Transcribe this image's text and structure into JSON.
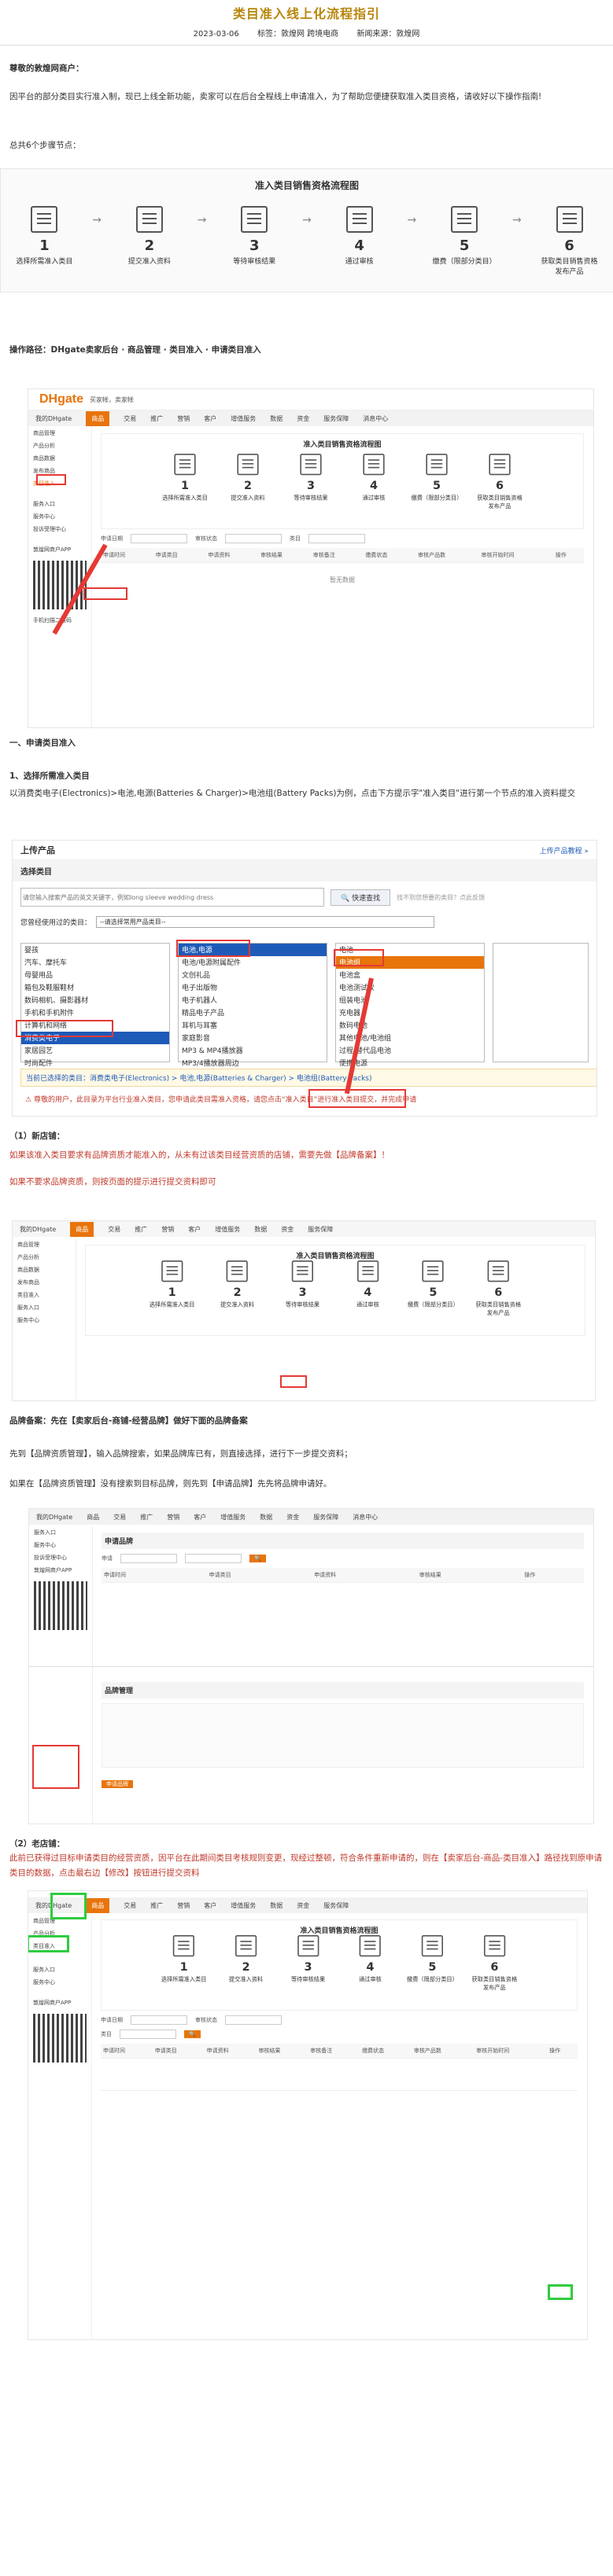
{
  "header": {
    "title": "类目准入线上化流程指引",
    "date": "2023-03-06",
    "tags": "标签：敦煌网 跨境电商",
    "source": "新闻来源：敦煌网"
  },
  "intro": {
    "greeting": "尊敬的敦煌网商户：",
    "para": "因平台的部分类目实行准入制，现已上线全新功能，卖家可以在后台全程线上申请准入，为了帮助您便捷获取准入类目资格，请收好以下操作指南!",
    "steps_total": "总共6个步骤节点："
  },
  "flow": {
    "title": "准入类目销售资格流程图",
    "steps": [
      {
        "num": "1",
        "label": "选择所需准入类目"
      },
      {
        "num": "2",
        "label": "提交准入资料"
      },
      {
        "num": "3",
        "label": "等待审核结果"
      },
      {
        "num": "4",
        "label": "通过审核"
      },
      {
        "num": "5",
        "label": "缴费（限部分类目）"
      },
      {
        "num": "6",
        "label": "获取类目销售资格\n发布产品"
      }
    ]
  },
  "entry": {
    "label": "操作路径：",
    "path": "DHgate卖家后台 · 商品管理 · 类目准入 · 申请类目准入"
  },
  "admin": {
    "logo": "DHgate",
    "topbar_text": "买家帐，卖家帐",
    "nav": [
      "我的DHgate",
      "商品",
      "交易",
      "推广",
      "营销",
      "客户",
      "增值服务",
      "数据",
      "资金",
      "服务保障",
      "消息中心"
    ],
    "side": [
      "商品管理",
      "商品管理",
      "产品分析",
      "商品数据",
      "发布商品",
      "类目准入",
      "服务入口",
      "服务中心",
      "投诉受理中心",
      "敦煌网商户APP",
      "手机扫描二维码"
    ],
    "menu": [
      "商品管理",
      "发布商品",
      "产品分析",
      "商品数据",
      "类目准入",
      "类目准入"
    ],
    "form_labels": [
      "申请日期",
      "审核状态",
      "类目",
      "申请",
      "申请"
    ],
    "table_head": [
      "申请时间",
      "申请类目",
      "申请资料",
      "审核结果",
      "审核备注",
      "缴费状态",
      "审核产品数",
      "审核开始时间",
      "操作"
    ],
    "empty": "暂无数据"
  },
  "section1": {
    "title": "一、申请类目准入",
    "sub": "1、选择所需准入类目",
    "desc": "以消费类电子(Electronics)>电池,电源(Batteries & Charger)>电池组(Battery Packs)为例，点击下方提示字\"准入类目\"进行第一个节点的准入资料提交"
  },
  "upload": {
    "title": "上传产品",
    "link": "上传产品教程 »",
    "select_label": "选择类目",
    "search_placeholder": "请您输入搜索产品的英文关键字，例如long sleeve wedding dress",
    "search_btn": "快速查找",
    "search_hint": "找不到您想要的类目？点此反馈",
    "used_label": "您曾经使用过的类目：",
    "used_value": "--请选择常用产品类目--",
    "col1": [
      "婴孩",
      "汽车、摩托车",
      "母婴用品",
      "箱包及鞋服鞋材",
      "数码相机、摄影器材",
      "手机和手机附件",
      "计算机和网络",
      "消费类电子",
      "家居园艺",
      "时尚配件"
    ],
    "col2": [
      "电池,电源",
      "电池/电源附属配件",
      "文创礼品",
      "电子出版物",
      "电子机器人",
      "精品电子产品",
      "耳机与耳塞",
      "家庭影音",
      "MP3 & MP4播放器",
      "MP3/4播放器周边",
      "存储卡及U盘"
    ],
    "col3": [
      "电池",
      "电池组",
      "电池盒",
      "电池测试仪",
      "组装电池",
      "充电器",
      "数码电池",
      "其他电池/电池组",
      "过程/替代品电池",
      "便携电源",
      "电池电源头"
    ],
    "current": "当前已选择的类目：消费类电子(Electronics) > 电池,电源(Batteries & Charger) > 电池组(Battery Packs)",
    "notice": "尊敬的用户，此目录为平台行业准入类目，您申请此类目需准入资格，请您点击“准入类目”进行准入类目提交，并完成申请"
  },
  "new_store": {
    "title": "（1）新店铺：",
    "line1": "如果该准入类目要求有品牌资质才能准入的，从未有过该类目经营资质的店铺，需要先做【品牌备案】！",
    "line2": "如果不要求品牌资质，则按页面的提示进行提交资料即可"
  },
  "brand": {
    "title": "品牌备案：先在【卖家后台-商铺-经营品牌】做好下面的品牌备案",
    "line1": "先到【品牌资质管理】，输入品牌搜索，如果品牌库已有，则直接选择，进行下一步提交资料；",
    "line2": "如果在【品牌资质管理】没有搜索到目标品牌，则先到【申请品牌】先先将品牌申请好。",
    "apply_title": "申请品牌",
    "manage_title": "品牌管理"
  },
  "old_store": {
    "title": "（2）老店铺：",
    "text": "此前已获得过目标申请类目的经营资质，因平台在此期间类目考核规则变更，现经过整顿，符合条件重新申请的，则在【卖家后台-商品-类目准入】路径找到原申请类目的数据，点击最右边【修改】按钮进行提交资料"
  },
  "colors": {
    "accent": "#e8740c",
    "red": "#e53935",
    "green": "#2ecc40",
    "title": "#b8860b"
  }
}
